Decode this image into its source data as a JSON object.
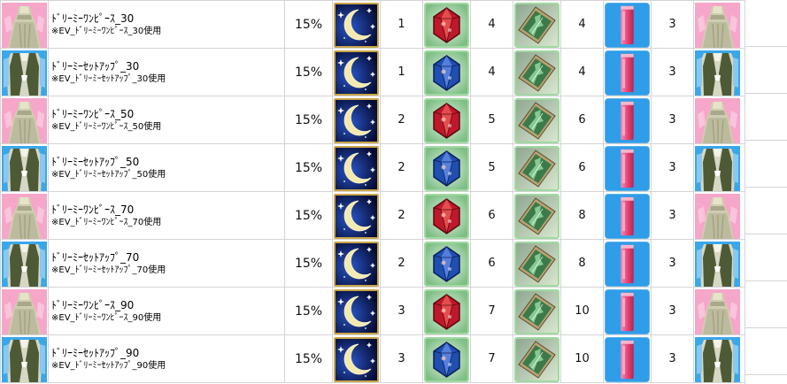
{
  "rows": [
    {
      "name": "ﾄﾞﾘｰﾐｰﾜﾝﾋﾟｰｽ_30",
      "note": "※EV_ﾄﾞﾘｰﾐｰﾜﾝﾋﾟｰｽ_30使用",
      "rate": "15%",
      "moon": "1",
      "gem": "4",
      "card": "4",
      "tube": "3",
      "outfit": "dress",
      "gemColor": "red"
    },
    {
      "name": "ﾄﾞﾘｰﾐｰｾｯﾄｱｯﾌﾟ_30",
      "note": "※EV_ﾄﾞﾘｰﾐｰｾｯﾄｱｯﾌﾟ_30使用",
      "rate": "15%",
      "moon": "1",
      "gem": "4",
      "card": "4",
      "tube": "3",
      "outfit": "suit",
      "gemColor": "blue"
    },
    {
      "name": "ﾄﾞﾘｰﾐｰﾜﾝﾋﾟｰｽ_50",
      "note": "※EV_ﾄﾞﾘｰﾐｰﾜﾝﾋﾟｰｽ_50使用",
      "rate": "15%",
      "moon": "2",
      "gem": "5",
      "card": "6",
      "tube": "3",
      "outfit": "dress",
      "gemColor": "red"
    },
    {
      "name": "ﾄﾞﾘｰﾐｰｾｯﾄｱｯﾌﾟ_50",
      "note": "※EV_ﾄﾞﾘｰﾐｰｾｯﾄｱｯﾌﾟ_50使用",
      "rate": "15%",
      "moon": "2",
      "gem": "5",
      "card": "6",
      "tube": "3",
      "outfit": "suit",
      "gemColor": "blue"
    },
    {
      "name": "ﾄﾞﾘｰﾐｰﾜﾝﾋﾟｰｽ_70",
      "note": "※EV_ﾄﾞﾘｰﾐｰﾜﾝﾋﾟｰｽ_70使用",
      "rate": "15%",
      "moon": "2",
      "gem": "6",
      "card": "8",
      "tube": "3",
      "outfit": "dress",
      "gemColor": "red"
    },
    {
      "name": "ﾄﾞﾘｰﾐｰｾｯﾄｱｯﾌﾟ_70",
      "note": "※EV_ﾄﾞﾘｰﾐｰｾｯﾄｱｯﾌﾟ_70使用",
      "rate": "15%",
      "moon": "2",
      "gem": "6",
      "card": "8",
      "tube": "3",
      "outfit": "suit",
      "gemColor": "blue"
    },
    {
      "name": "ﾄﾞﾘｰﾐｰﾜﾝﾋﾟｰｽ_90",
      "note": "※EV_ﾄﾞﾘｰﾐｰﾜﾝﾋﾟｰｽ_90使用",
      "rate": "15%",
      "moon": "3",
      "gem": "7",
      "card": "10",
      "tube": "3",
      "outfit": "dress",
      "gemColor": "red"
    },
    {
      "name": "ﾄﾞﾘｰﾐｰｾｯﾄｱｯﾌﾟ_90",
      "note": "※EV_ﾄﾞﾘｰﾐｰｾｯﾄｱｯﾌﾟ_90使用",
      "rate": "15%",
      "moon": "3",
      "gem": "7",
      "card": "10",
      "tube": "3",
      "outfit": "suit",
      "gemColor": "blue"
    }
  ],
  "icons": {
    "dress": "pink-dress-outfit-icon",
    "suit": "green-suit-outfit-icon",
    "moon": "crescent-moon-item-icon",
    "gem": "crystal-gem-item-icon",
    "card": "green-card-item-icon",
    "tube": "pink-tube-item-icon"
  },
  "colors": {
    "dressBg": "#f6a6c8",
    "suitBg": "#3aa7ea",
    "moonBg": "#0b1a5c",
    "gemRed": "#c0182a",
    "gemBlue": "#1f4fb0",
    "cardBg": "#3c7a4a",
    "tubeBg": "#2f9de8",
    "tubePink": "#e8467a",
    "gridLine": "#d4d4d4"
  }
}
